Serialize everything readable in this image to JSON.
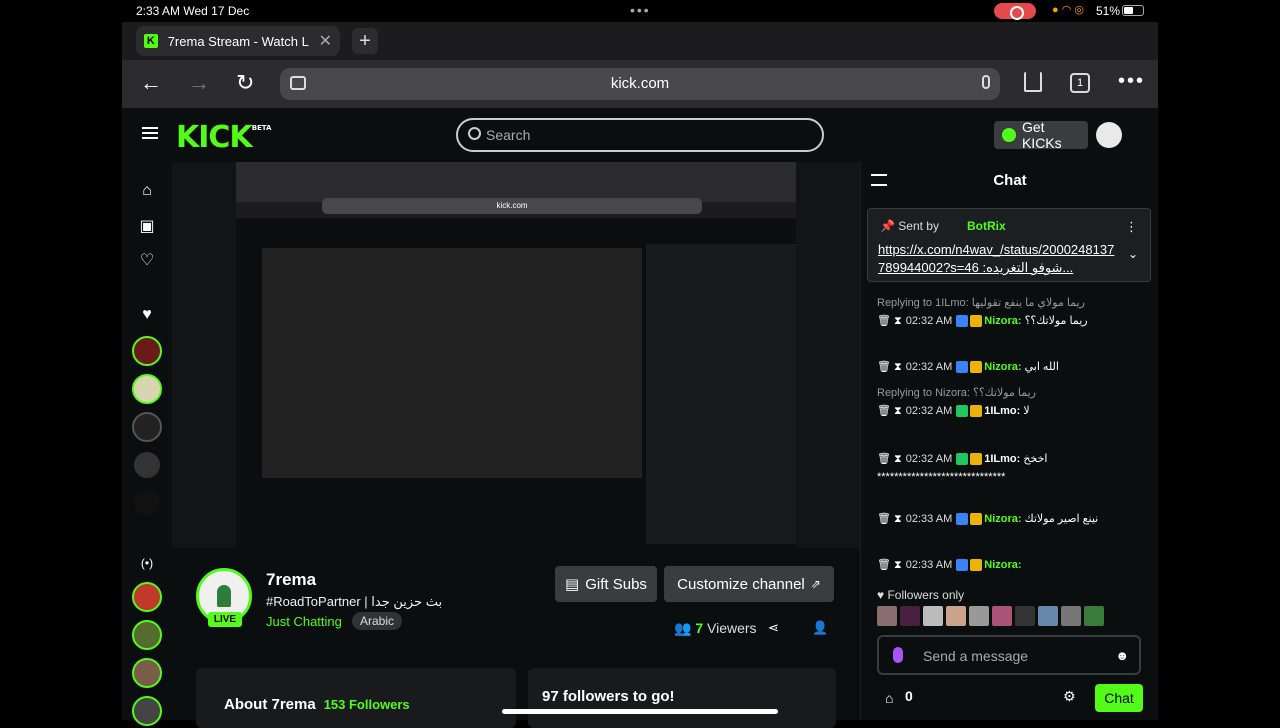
{
  "status": {
    "time": "2:33 AM",
    "date": "Wed 17 Dec",
    "battery": "51%"
  },
  "tab": {
    "title": "7rema Stream - Watch L"
  },
  "address": {
    "url": "kick.com",
    "tab_count": "1"
  },
  "header": {
    "logo": "KICK",
    "beta": "BETA",
    "search_placeholder": "Search",
    "get_kicks": "Get KICKs"
  },
  "channel": {
    "name": "7rema",
    "live": "LIVE",
    "title": "#RoadToPartner | بث حزين جدا",
    "category": "Just Chatting",
    "tag": "Arabic",
    "viewers": "7",
    "viewers_label": "Viewers",
    "gift": "Gift Subs",
    "customize": "Customize channel",
    "about": "About 7rema",
    "followers": "153 Followers",
    "goal": "97 followers to go!"
  },
  "nested": {
    "url": "kick.com",
    "chat_title": "Chat"
  },
  "chat": {
    "title": "Chat",
    "pinned": {
      "sent_by": "Sent by",
      "bot": "BotRix",
      "url": "https://x.com/n4wav_/status/2000248137789944002?s=46 :شوفو التغريده..."
    },
    "messages": [
      {
        "time": "02:32 AM",
        "name": "Nizora:",
        "text": "ريما مولاتك؟؟",
        "reply": "Replying to 1ILmo: ريما مولاي ما ينفع تقوليها"
      },
      {
        "time": "02:32 AM",
        "name": "Nizora:",
        "text": "الله ابي",
        "reply": ""
      },
      {
        "time": "02:32 AM",
        "name": "1ILmo:",
        "text": "لا",
        "reply": "Replying to Nizora: ريما مولاتك؟؟"
      },
      {
        "time": "02:32 AM",
        "name": "1ILmo:",
        "text": "اخخخ ******************************",
        "reply": ""
      },
      {
        "time": "02:33 AM",
        "name": "Nizora:",
        "text": "نينع اصير مولاتك",
        "reply": ""
      },
      {
        "time": "02:33 AM",
        "name": "Nizora:",
        "text": "",
        "reply": ""
      }
    ],
    "followers_only": "Followers only",
    "placeholder": "Send a message",
    "points": "0",
    "send": "Chat"
  }
}
